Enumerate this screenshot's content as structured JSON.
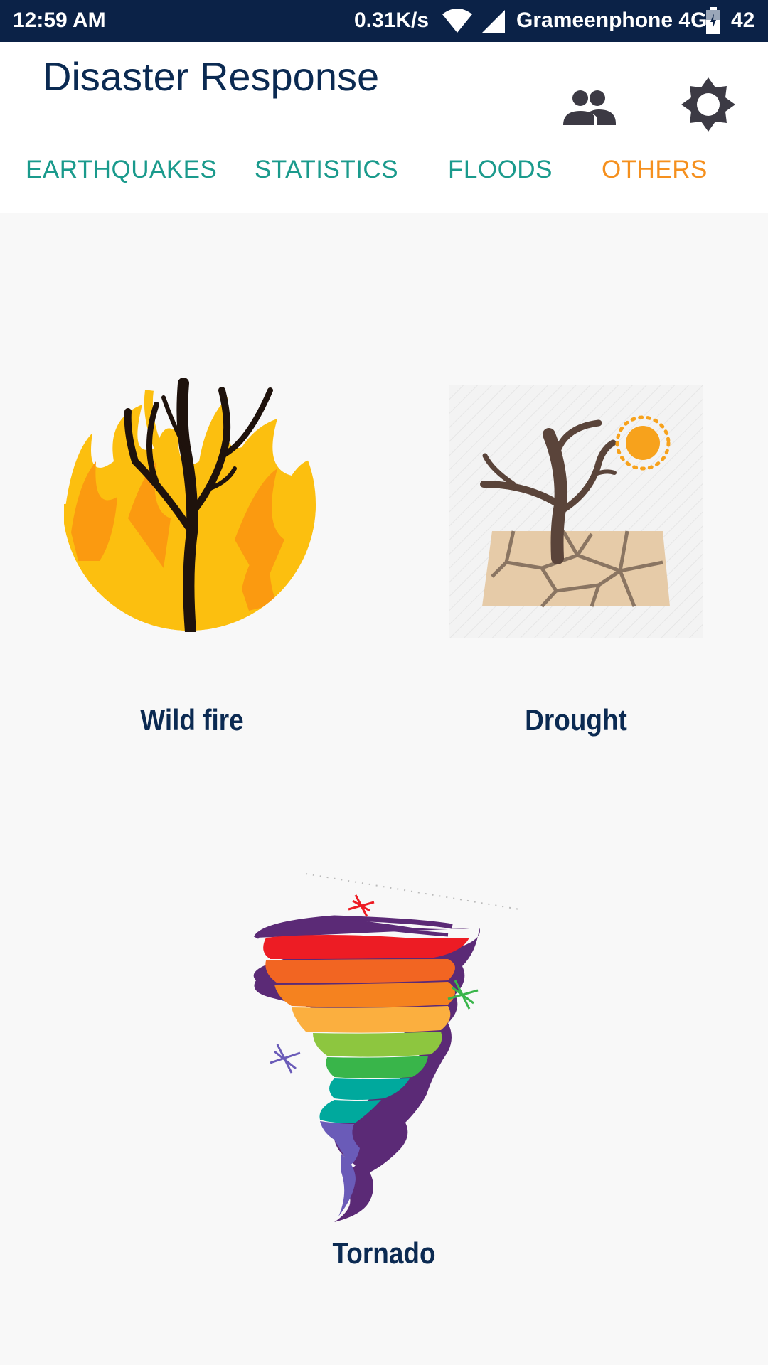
{
  "status_bar": {
    "time": "12:59 AM",
    "speed": "0.31K/s",
    "carrier": "Grameenphone 4G",
    "battery": "42",
    "icons": [
      "wifi-icon",
      "signal-icon",
      "battery-icon"
    ]
  },
  "app_bar": {
    "title": "Disaster Response",
    "actions": [
      "people-icon",
      "settings-icon"
    ]
  },
  "tabs": {
    "items": [
      {
        "label": "EARTHQUAKES"
      },
      {
        "label": "STATISTICS"
      },
      {
        "label": "FLOODS"
      },
      {
        "label": "OTHERS"
      }
    ],
    "active": "OTHERS"
  },
  "disasters": [
    {
      "label": "Wild fire",
      "icon": "wildfire-icon"
    },
    {
      "label": "Drought",
      "icon": "drought-icon"
    },
    {
      "label": "Tornado",
      "icon": "tornado-icon"
    }
  ],
  "colors": {
    "status_bar_bg": "#0b2247",
    "title": "#0b2a52",
    "tab": "#1a9a8c",
    "tab_active": "#f5901e",
    "background": "#f8f8f8"
  }
}
